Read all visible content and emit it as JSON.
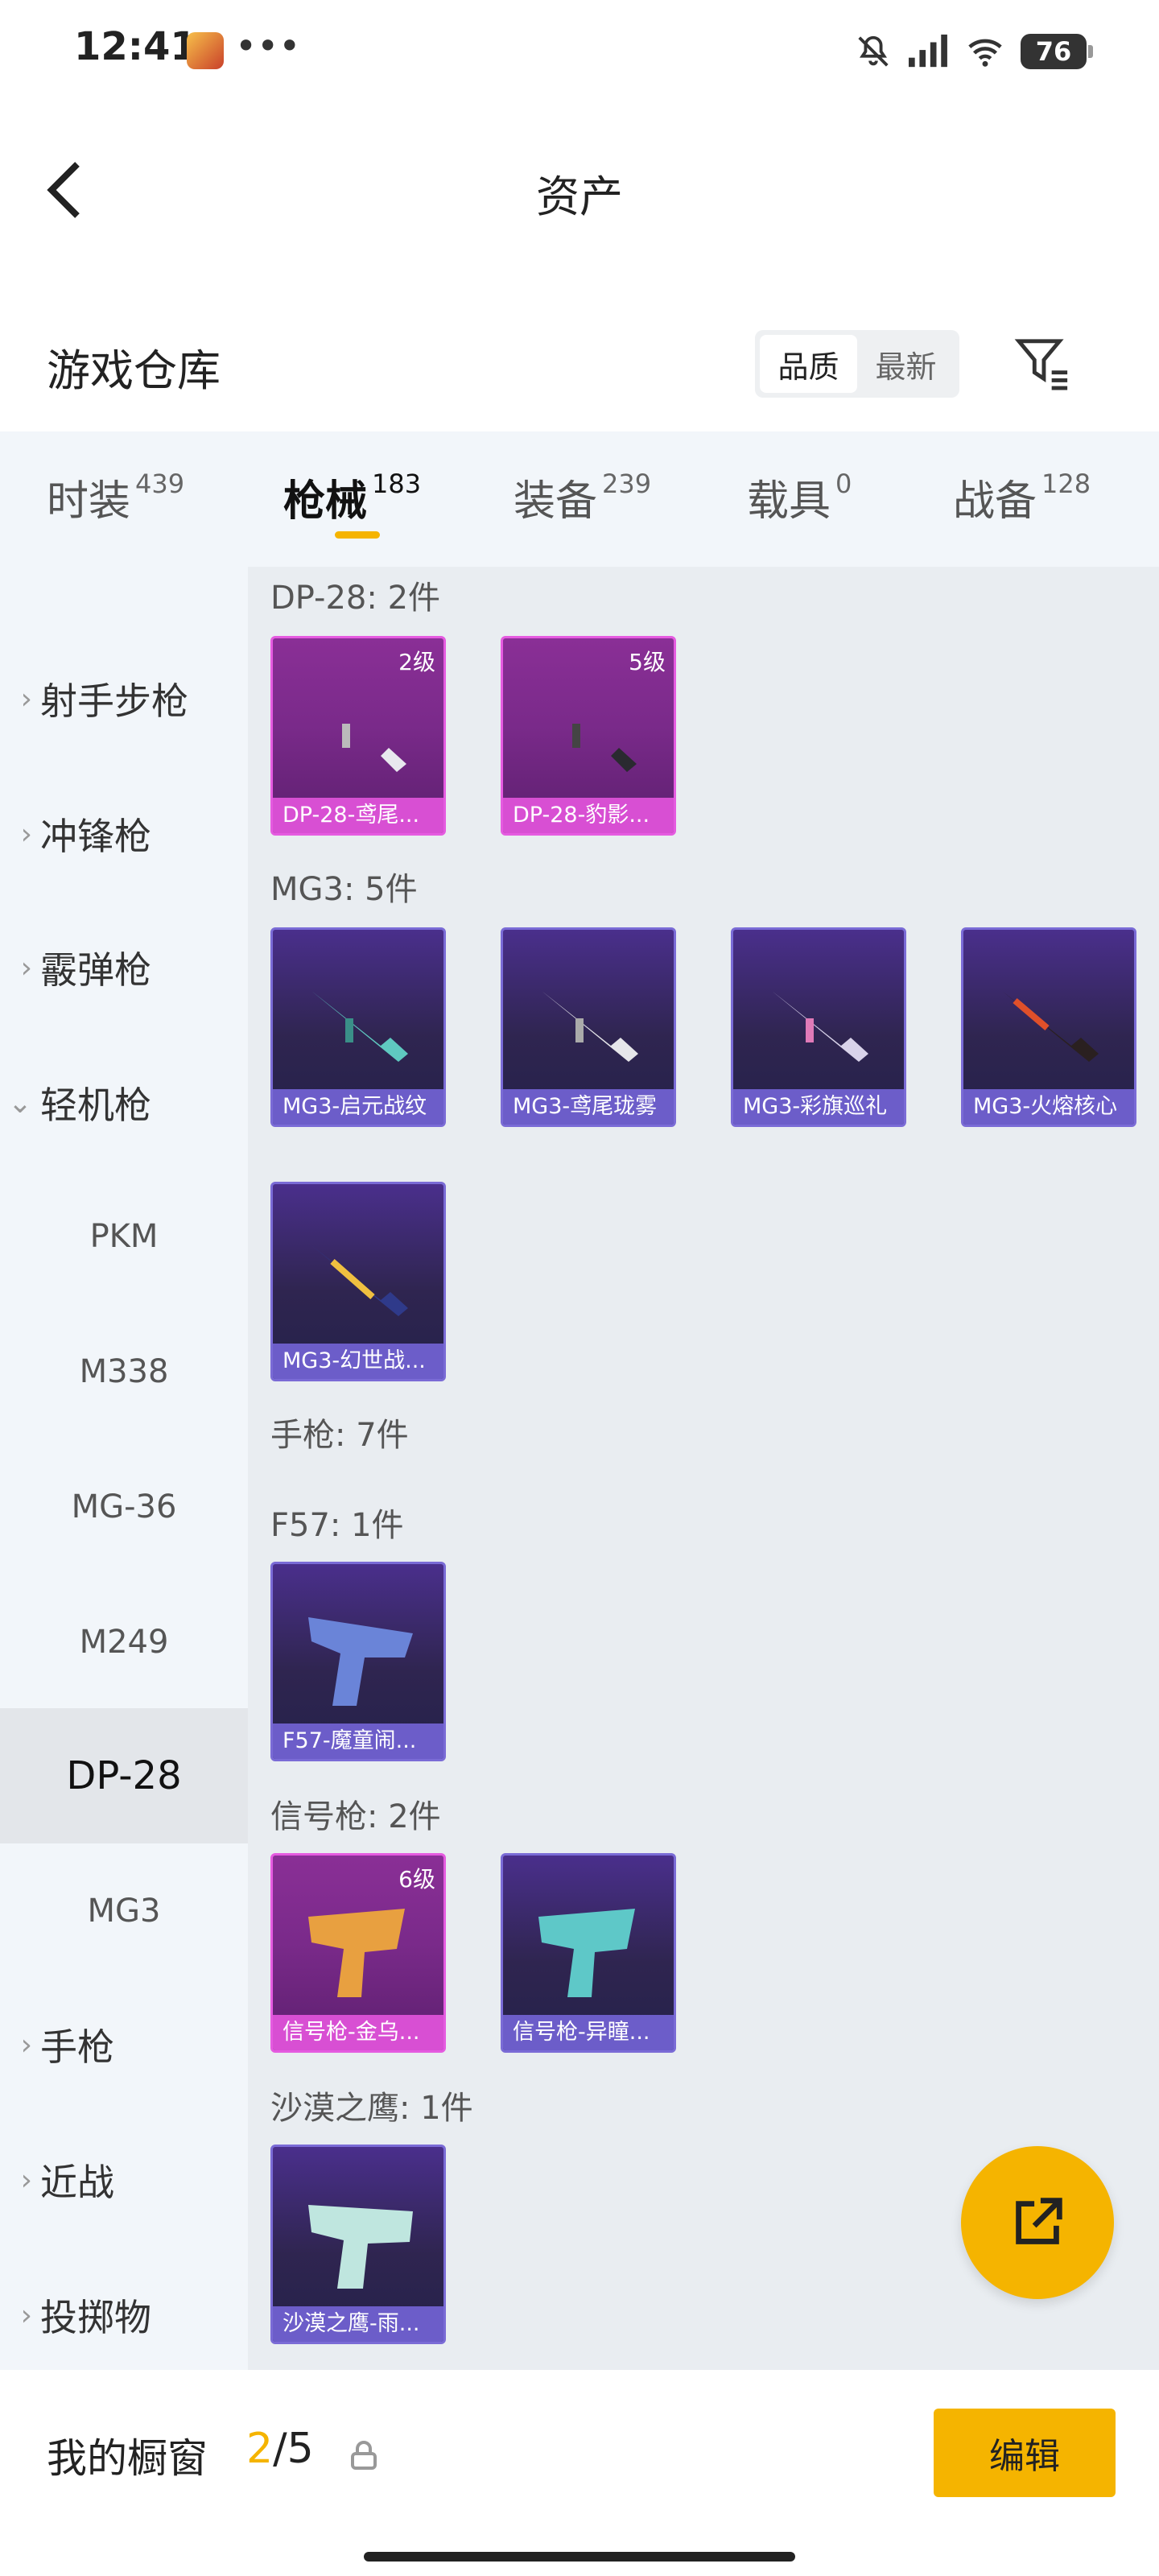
{
  "status": {
    "time": "12:41",
    "dots": "•••",
    "battery": "76"
  },
  "nav": {
    "title": "资产"
  },
  "section": {
    "title": "游戏仓库",
    "sort_options": [
      "品质",
      "最新"
    ]
  },
  "tabs": [
    {
      "label": "时装",
      "count": "439"
    },
    {
      "label": "枪械",
      "count": "183"
    },
    {
      "label": "装备",
      "count": "239"
    },
    {
      "label": "载具",
      "count": "0"
    },
    {
      "label": "战备",
      "count": "128"
    }
  ],
  "sidebar": [
    {
      "label": "射手步枪"
    },
    {
      "label": "冲锋枪"
    },
    {
      "label": "霰弹枪"
    },
    {
      "label": "轻机枪"
    },
    {
      "label": "PKM"
    },
    {
      "label": "M338"
    },
    {
      "label": "MG-36"
    },
    {
      "label": "M249"
    },
    {
      "label": "DP-28"
    },
    {
      "label": "MG3"
    },
    {
      "label": "手枪"
    },
    {
      "label": "近战"
    },
    {
      "label": "投掷物"
    }
  ],
  "groups": [
    {
      "title": "DP-28: 2件"
    },
    {
      "title": "MG3: 5件"
    },
    {
      "title": "手枪: 7件"
    },
    {
      "title": "F57: 1件"
    },
    {
      "title": "信号枪: 2件"
    },
    {
      "title": "沙漠之鹰: 1件"
    }
  ],
  "cards": [
    {
      "name": "DP-28-鸢尾...",
      "level": "2级"
    },
    {
      "name": "DP-28-豹影...",
      "level": "5级"
    },
    {
      "name": "MG3-启元战纹",
      "level": ""
    },
    {
      "name": "MG3-鸢尾珑雾",
      "level": ""
    },
    {
      "name": "MG3-彩旗巡礼",
      "level": ""
    },
    {
      "name": "MG3-火熔核心",
      "level": ""
    },
    {
      "name": "MG3-幻世战...",
      "level": ""
    },
    {
      "name": "F57-魔童闹...",
      "level": ""
    },
    {
      "name": "信号枪-金乌...",
      "level": "6级"
    },
    {
      "name": "信号枪-异瞳...",
      "level": ""
    },
    {
      "name": "沙漠之鹰-雨...",
      "level": ""
    }
  ],
  "bottom": {
    "label": "我的橱窗",
    "count_active": "2",
    "count_total": "/5",
    "edit_label": "编辑"
  },
  "colors": {
    "accent": "#f5b400",
    "purple_card": "#6c5dc9",
    "pink_card": "#d84fd3"
  }
}
